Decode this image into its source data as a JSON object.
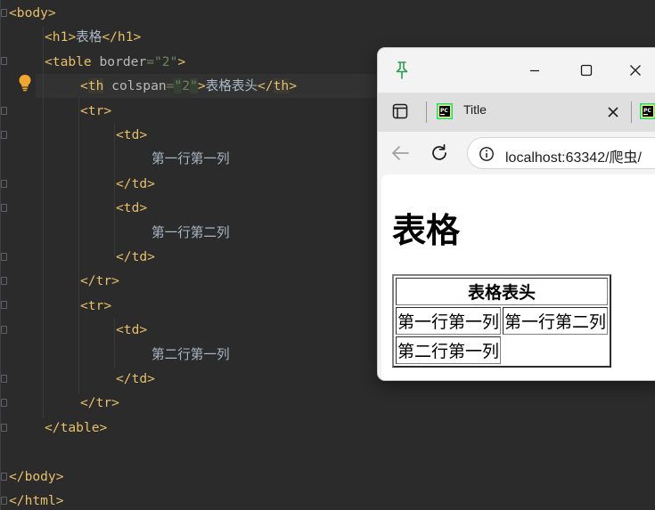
{
  "editor": {
    "lines": [
      {
        "parts": [
          {
            "t": "<body>",
            "c": "tag"
          }
        ]
      },
      {
        "parts": [
          {
            "t": "<h1>",
            "c": "tag"
          },
          {
            "t": "表格",
            "c": "txt"
          },
          {
            "t": "</h1>",
            "c": "tag"
          }
        ]
      },
      {
        "parts": [
          {
            "t": "<table ",
            "c": "tag"
          },
          {
            "t": "border",
            "c": "attr"
          },
          {
            "t": "=\"2\"",
            "c": "val"
          },
          {
            "t": ">",
            "c": "tag"
          }
        ]
      },
      {
        "parts": [
          {
            "t": "<",
            "c": "tag"
          },
          {
            "t": "th",
            "c": "tag hl"
          },
          {
            "t": " colspan",
            "c": "attr"
          },
          {
            "t": "=",
            "c": "val"
          },
          {
            "t": "\"",
            "c": "val quote-hl"
          },
          {
            "t": "2",
            "c": "val"
          },
          {
            "t": "\"",
            "c": "val quote-hl"
          },
          {
            "t": ">",
            "c": "tag"
          },
          {
            "t": "表格表头",
            "c": "txt"
          },
          {
            "t": "</",
            "c": "tag"
          },
          {
            "t": "th",
            "c": "tag hl"
          },
          {
            "t": ">",
            "c": "tag"
          }
        ]
      },
      {
        "parts": [
          {
            "t": "<tr>",
            "c": "tag"
          }
        ]
      },
      {
        "parts": [
          {
            "t": "<td>",
            "c": "tag"
          }
        ]
      },
      {
        "parts": [
          {
            "t": "第一行第一列",
            "c": "txt"
          }
        ]
      },
      {
        "parts": [
          {
            "t": "</td>",
            "c": "tag"
          }
        ]
      },
      {
        "parts": [
          {
            "t": "<td>",
            "c": "tag"
          }
        ]
      },
      {
        "parts": [
          {
            "t": "第一行第二列",
            "c": "txt"
          }
        ]
      },
      {
        "parts": [
          {
            "t": "</td>",
            "c": "tag"
          }
        ]
      },
      {
        "parts": [
          {
            "t": "</tr>",
            "c": "tag"
          }
        ]
      },
      {
        "parts": [
          {
            "t": "<tr>",
            "c": "tag"
          }
        ]
      },
      {
        "parts": [
          {
            "t": "<td>",
            "c": "tag"
          }
        ]
      },
      {
        "parts": [
          {
            "t": "第二行第一列",
            "c": "txt"
          }
        ]
      },
      {
        "parts": [
          {
            "t": "</td>",
            "c": "tag"
          }
        ]
      },
      {
        "parts": [
          {
            "t": "</tr>",
            "c": "tag"
          }
        ]
      },
      {
        "parts": [
          {
            "t": "</table>",
            "c": "tag"
          }
        ]
      },
      {
        "parts": []
      },
      {
        "parts": [
          {
            "t": "</body>",
            "c": "tag"
          }
        ]
      },
      {
        "parts": [
          {
            "t": "</html>",
            "c": "tag"
          }
        ]
      }
    ]
  },
  "browser": {
    "tab_title": "Title",
    "url": "localhost:63342/爬虫/",
    "page": {
      "heading": "表格",
      "table": {
        "header": "表格表头",
        "rows": [
          [
            "第一行第一列",
            "第一行第二列"
          ],
          [
            "第二行第一列"
          ]
        ]
      }
    }
  },
  "icons": {
    "pin": "pin-icon",
    "minimize": "minimize-icon",
    "maximize": "maximize-icon",
    "close": "close-icon",
    "sidebar": "sidebar-toggle-icon",
    "tab_favicon": "pycharm-icon",
    "tab_close": "close-icon",
    "back": "back-arrow-icon",
    "reload": "reload-icon",
    "site_info": "info-icon",
    "bulb": "lightbulb-icon"
  },
  "colors": {
    "editor_bg": "#2b2b2b",
    "tag": "#e8bf6a",
    "attr": "#bababa",
    "value": "#6a8759",
    "text": "#a9b7c6",
    "pin_green": "#2e9d4f",
    "bulb": "#f0a732"
  }
}
